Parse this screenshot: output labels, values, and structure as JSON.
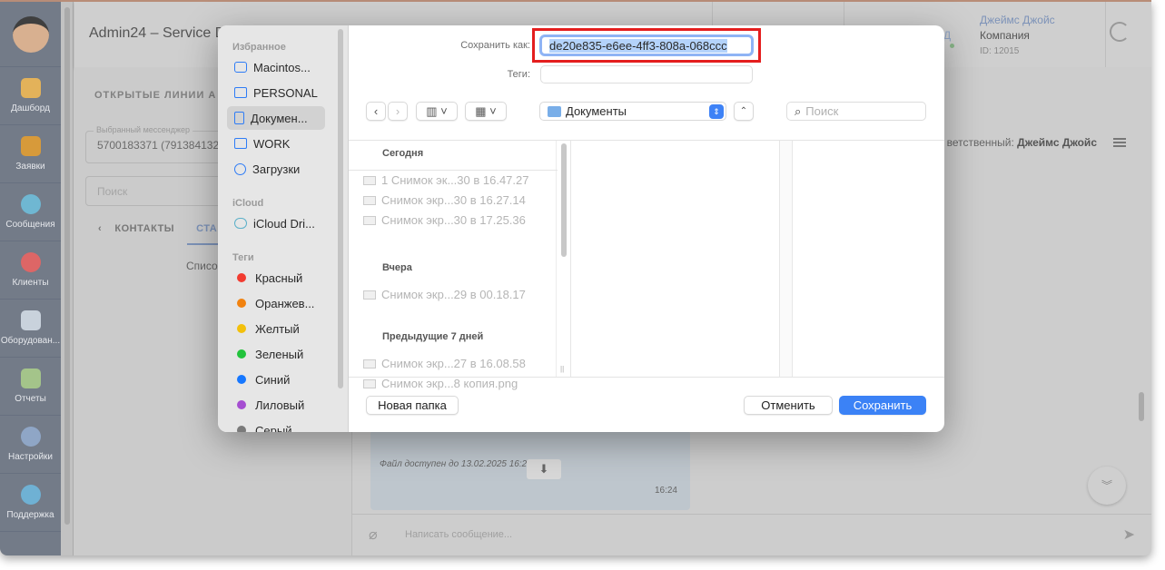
{
  "app": {
    "title": "Admin24 – Service De",
    "user": {
      "name": "Джеймс Джойс",
      "company": "Компания",
      "id": "ID: 12015",
      "initial": "Д"
    },
    "nav": [
      {
        "label": "Дашборд",
        "color": "#e3b25a"
      },
      {
        "label": "Заявки",
        "color": "#d79a3a"
      },
      {
        "label": "Сообщения",
        "color": "#6fb7d2"
      },
      {
        "label": "Клиенты",
        "color": "#d66"
      },
      {
        "label": "Оборудован...",
        "color": "#c9d2dc"
      },
      {
        "label": "Отчеты",
        "color": "#a4c48a"
      },
      {
        "label": "Настройки",
        "color": "#8fa6c6"
      },
      {
        "label": "Поддержка",
        "color": "#6fb1d4"
      }
    ],
    "left": {
      "section": "ОТКРЫТЫЕ ЛИНИИ А",
      "messenger_label": "Выбранный мессенджер",
      "messenger_value": "5700183371 (7913841322",
      "search_placeholder": "Поиск",
      "tab_contacts": "КОНТАКТЫ",
      "tab_active": "СТА",
      "list_text": "Списо"
    },
    "chat": {
      "responsible_label": "ветственный:",
      "responsible": "Джеймс Джойс",
      "file_note": "Файл доступен до 13.02.2025 16:24",
      "time": "16:24",
      "placeholder": "Написать сообщение..."
    }
  },
  "dialog": {
    "save_as_label": "Сохранить как:",
    "filename": "de20e835-e6ee-4ff3-808a-068ccc",
    "tags_label": "Теги:",
    "location": "Документы",
    "search_placeholder": "Поиск",
    "sidebar": {
      "favorites": "Избранное",
      "items": [
        "Macintos...",
        "PERSONAL",
        "Докумен...",
        "WORK",
        "Загрузки"
      ],
      "icloud": "iCloud",
      "icloud_items": [
        "iCloud Dri..."
      ],
      "tags_header": "Теги",
      "tags": [
        {
          "label": "Красный",
          "color": "#f23b30"
        },
        {
          "label": "Оранжев...",
          "color": "#f1820f"
        },
        {
          "label": "Желтый",
          "color": "#f3c00b"
        },
        {
          "label": "Зеленый",
          "color": "#22c33c"
        },
        {
          "label": "Синий",
          "color": "#1677ff"
        },
        {
          "label": "Лиловый",
          "color": "#a54ed1"
        },
        {
          "label": "Серый",
          "color": "#7a7a7a"
        }
      ]
    },
    "groups": [
      {
        "title": "Сегодня",
        "files": [
          "1 Снимок эк...30 в 16.47.27",
          "Снимок экр...30 в 16.27.14",
          "Снимок экр...30 в 17.25.36"
        ]
      },
      {
        "title": "Вчера",
        "files": [
          "Снимок экр...29 в 00.18.17"
        ]
      },
      {
        "title": "Предыдущие 7 дней",
        "files": [
          "Снимок экр...27 в 16.08.58",
          "Снимок экр...8 копия.png"
        ]
      }
    ],
    "new_folder": "Новая папка",
    "cancel": "Отменить",
    "save": "Сохранить"
  }
}
